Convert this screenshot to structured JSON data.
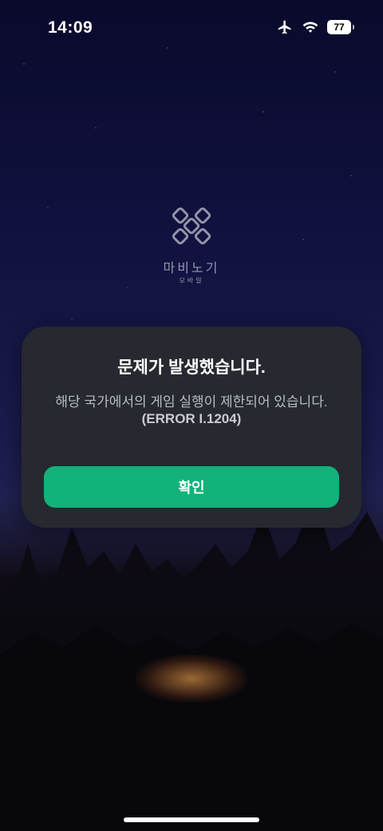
{
  "status_bar": {
    "time": "14:09",
    "battery_level": "77",
    "icons": [
      "airplane-icon",
      "wifi-icon",
      "battery-icon"
    ]
  },
  "logo": {
    "name": "마비노기",
    "subtitle": "모바일"
  },
  "dialog": {
    "title": "문제가 발생했습니다.",
    "message": "해당 국가에서의 게임 실행이 제한되어 있습니다.",
    "error_code": "(ERROR I.1204)",
    "confirm_label": "확인"
  },
  "colors": {
    "accent": "#12b27a",
    "dialog_bg": "#26292f",
    "title_text": "#ffffff",
    "message_text": "#b7bbc2"
  }
}
